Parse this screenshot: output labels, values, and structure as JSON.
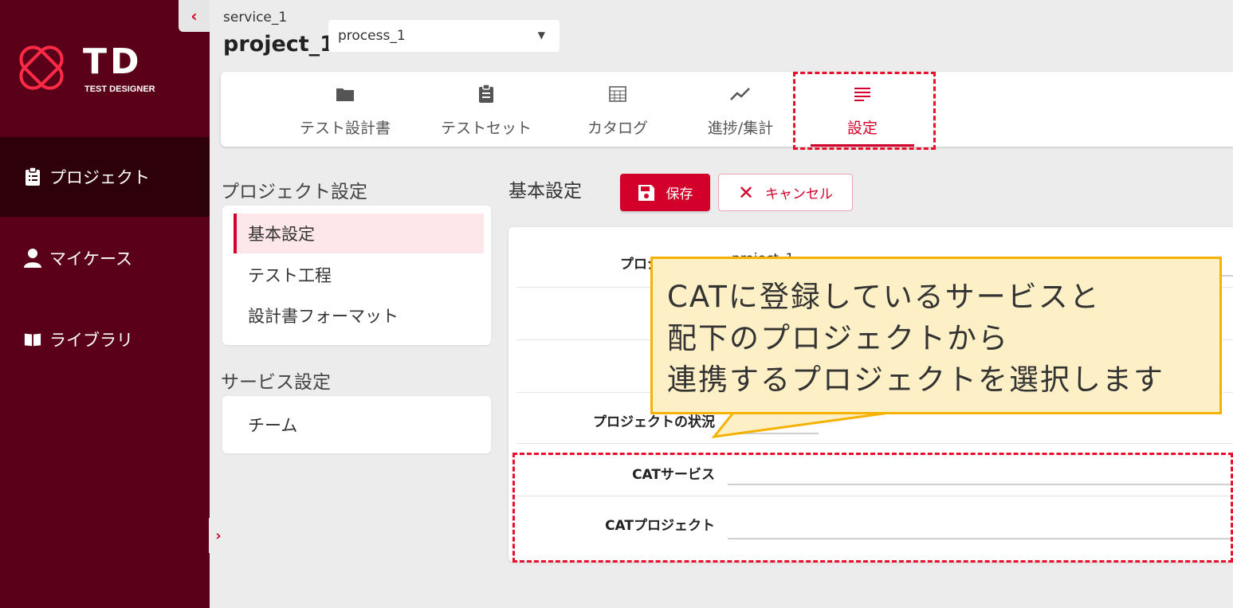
{
  "header": {
    "service": "service_1",
    "project": "project_1",
    "process_select": "process_1"
  },
  "logo": {
    "text": "TD",
    "subtitle": "TEST DESIGNER"
  },
  "sidebar": {
    "items": [
      {
        "label": "プロジェクト",
        "icon": "clipboard-icon",
        "active": true
      },
      {
        "label": "マイケース",
        "icon": "person-icon",
        "active": false
      },
      {
        "label": "ライブラリ",
        "icon": "book-icon",
        "active": false
      }
    ]
  },
  "tabs": [
    {
      "label": "テスト設計書",
      "icon": "folder-icon"
    },
    {
      "label": "テストセット",
      "icon": "clipboard-icon"
    },
    {
      "label": "カタログ",
      "icon": "catalog-icon"
    },
    {
      "label": "進捗/集計",
      "icon": "trend-icon"
    },
    {
      "label": "設定",
      "icon": "list-icon",
      "active": true
    }
  ],
  "settings": {
    "project_settings_title": "プロジェクト設定",
    "project_menu": [
      "基本設定",
      "テスト工程",
      "設計書フォーマット"
    ],
    "service_settings_title": "サービス設定",
    "service_menu": [
      "チーム"
    ]
  },
  "basic": {
    "title": "基本設定",
    "save_label": "保存",
    "cancel_label": "キャンセル"
  },
  "form": {
    "project_name_label": "プロジェクト名",
    "project_name_value": "project_1",
    "project_status_label": "プロジェクトの状況",
    "cat_service_label": "CATサービス",
    "cat_project_label": "CATプロジェクト"
  },
  "callout": {
    "line1": "CATに登録しているサービスと",
    "line2": "配下のプロジェクトから",
    "line3": "連携するプロジェクトを選択します"
  },
  "colors": {
    "sidebar": "#5b0019",
    "sidebar_active": "#2e0009",
    "accent": "#d2002a",
    "callout_bg": "#fdf0c6",
    "callout_border": "#f5b200",
    "highlight": "#e8102a"
  }
}
